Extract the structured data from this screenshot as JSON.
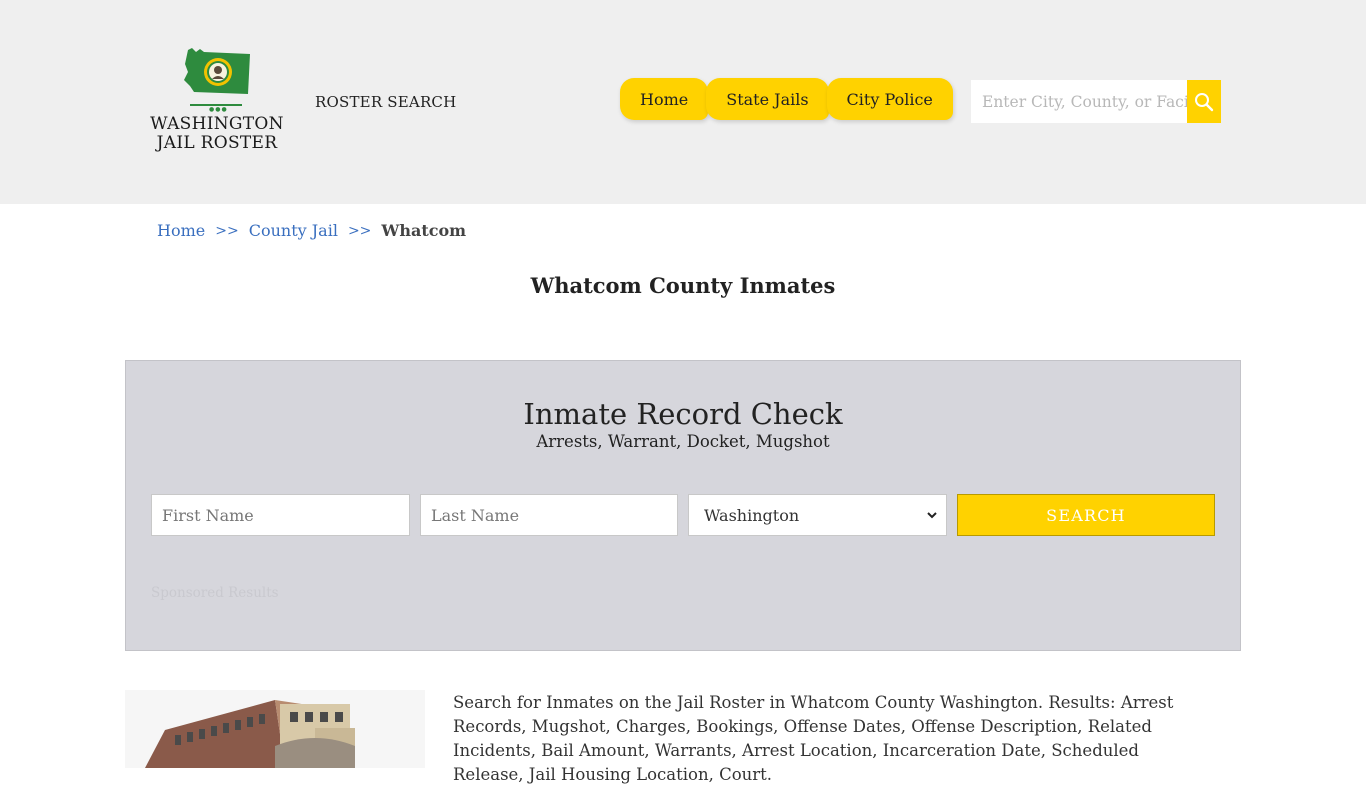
{
  "header": {
    "logo": {
      "line1": "WASHINGTON",
      "line2": "JAIL ROSTER"
    },
    "roster_search": "ROSTER SEARCH",
    "nav": [
      {
        "label": "Home"
      },
      {
        "label": "State Jails"
      },
      {
        "label": "City Police"
      }
    ],
    "search_placeholder": "Enter City, County, or Facility"
  },
  "breadcrumb": {
    "home": "Home",
    "sep": ">>",
    "county_jail": "County Jail",
    "current": "Whatcom"
  },
  "page_title": "Whatcom County Inmates",
  "record_check": {
    "title": "Inmate Record Check",
    "subtitle": "Arrests, Warrant, Docket, Mugshot",
    "first_name_placeholder": "First Name",
    "last_name_placeholder": "Last Name",
    "state_selected": "Washington",
    "search_label": "SEARCH",
    "sponsored": "Sponsored Results"
  },
  "description": "Search for Inmates on the Jail Roster in Whatcom County Washington. Results: Arrest Records, Mugshot, Charges, Bookings, Offense Dates, Offense Description, Related Incidents, Bail Amount, Warrants, Arrest Location, Incarceration Date, Scheduled Release, Jail Housing Location, Court.",
  "colors": {
    "accent": "#ffd200",
    "header_bg": "#efefef",
    "panel_bg": "#d6d6dc",
    "link": "#3a6fbf",
    "logo_green": "#2e8b3e"
  },
  "icons": {
    "search": "magnifier-icon",
    "select": "chevron-down-icon",
    "logo": "washington-state-seal-icon"
  }
}
